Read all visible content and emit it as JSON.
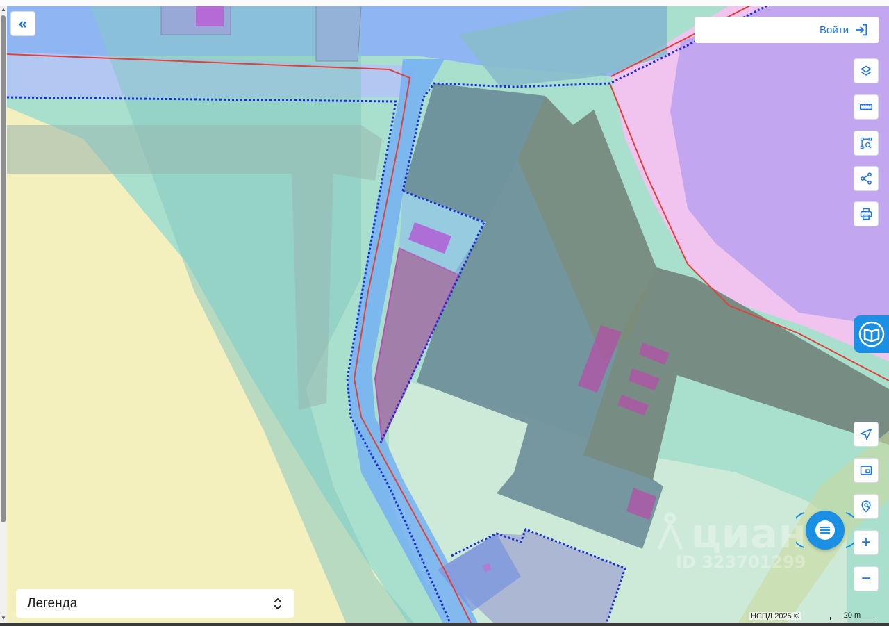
{
  "header": {
    "collapse_icon": "double-chevron-left-icon",
    "login_label": "Войти",
    "login_icon": "login-arrow-icon"
  },
  "toolbar_top": [
    {
      "name": "layers-icon"
    },
    {
      "name": "ruler-icon"
    },
    {
      "name": "area-select-icon"
    },
    {
      "name": "share-icon"
    },
    {
      "name": "print-icon"
    }
  ],
  "toolbar_bottom": [
    {
      "name": "geolocation-icon",
      "label": ""
    },
    {
      "name": "minimap-icon",
      "label": ""
    },
    {
      "name": "search-point-icon",
      "label": ""
    },
    {
      "name": "zoom-in-button",
      "label": "+"
    },
    {
      "name": "zoom-out-button",
      "label": "−"
    }
  ],
  "legend": {
    "label": "Легенда",
    "icon": "chevron-up-down-icon"
  },
  "footer": {
    "copyright": "НСПД 2025 ©",
    "scale_label": "20 m"
  },
  "watermark": {
    "brand": "циан",
    "id_text": "ID 323701299"
  },
  "colors": {
    "accent": "#1a73e8",
    "kadastr_tab": "#1a8fe3",
    "parcel_fill": "#6f8f9a",
    "boundary_red": "#e0413a",
    "boundary_dashed": "#1a2ed6",
    "zone_yellow": "#f4f0bd",
    "zone_mint": "#9fdcc8",
    "zone_pink": "#f1c4ee",
    "zone_violet": "#c3a8f2",
    "road_blue": "#7cb6f2",
    "building_magenta": "#b04fd0"
  }
}
